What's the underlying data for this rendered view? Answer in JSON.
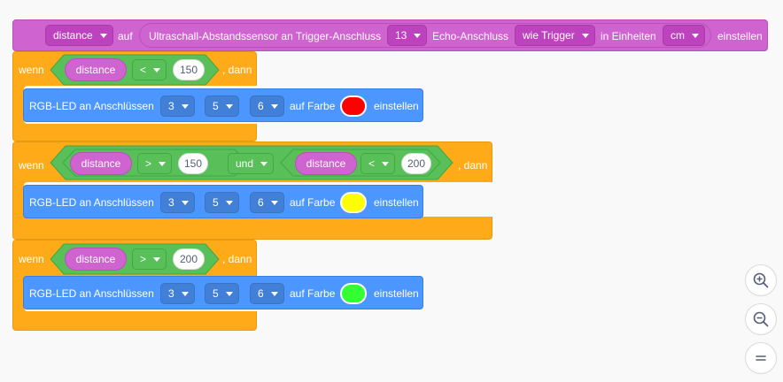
{
  "setter": {
    "variable": "distance",
    "auf": "auf",
    "sensor_text": "Ultraschall-Abstandssensor an Trigger-Anschluss",
    "trigger_pin": "13",
    "echo_text": "Echo-Anschluss",
    "echo_value": "wie Trigger",
    "units_text": "in Einheiten",
    "units_value": "cm",
    "einstellen": "einstellen"
  },
  "labels": {
    "wenn": "wenn",
    "dann": ", dann",
    "und": "und",
    "rgb": "RGB-LED an Anschlüssen",
    "auf_farbe": "auf Farbe",
    "einstellen": "einstellen"
  },
  "if1": {
    "var": "distance",
    "op": "<",
    "value": "150",
    "pins": [
      "3",
      "5",
      "6"
    ],
    "color": "#ff0000"
  },
  "if2": {
    "var1": "distance",
    "op1": ">",
    "value1": "150",
    "var2": "distance",
    "op2": "<",
    "value2": "200",
    "pins": [
      "3",
      "5",
      "6"
    ],
    "color": "#ffff00"
  },
  "if3": {
    "var": "distance",
    "op": ">",
    "value": "200",
    "pins": [
      "3",
      "5",
      "6"
    ],
    "color": "#33ff33"
  },
  "zoom": {
    "zoom_in_icon": "zoom-in-icon",
    "zoom_out_icon": "zoom-out-icon",
    "reset_icon": "reset-zoom-icon"
  }
}
